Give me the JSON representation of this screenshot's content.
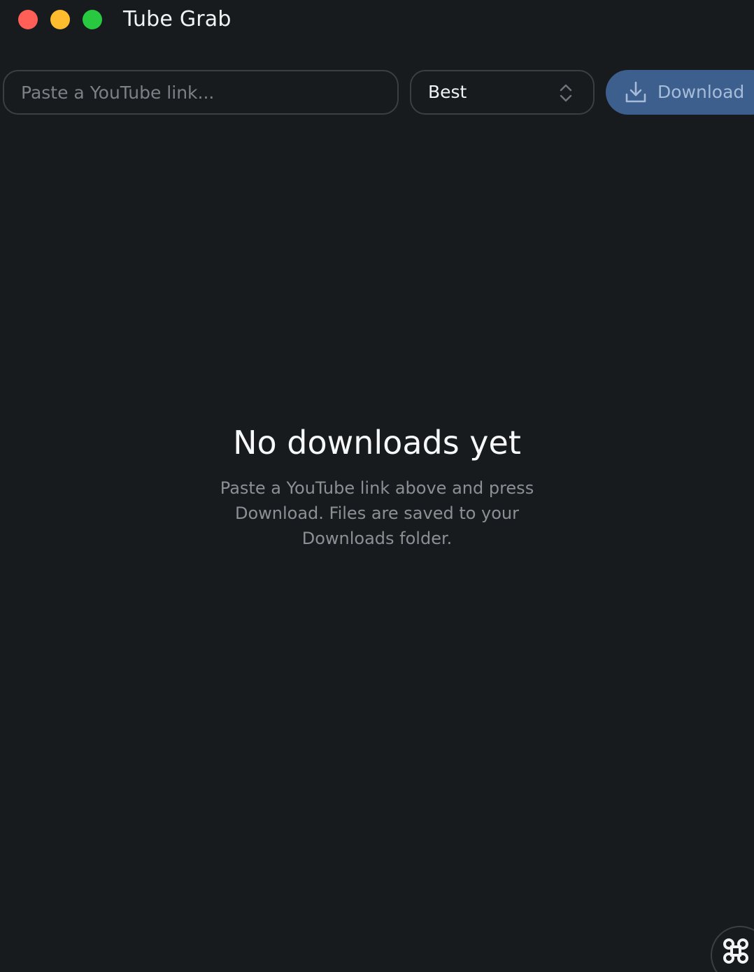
{
  "window": {
    "title": "Tube Grab",
    "controls": {
      "close_color": "#ff5f57",
      "minimize_color": "#febc2e",
      "zoom_color": "#28c840"
    }
  },
  "toolbar": {
    "url_input": {
      "placeholder": "Paste a YouTube link...",
      "value": ""
    },
    "quality_select": {
      "selected": "Best",
      "icon": "chevron-updown-icon"
    },
    "download_button": {
      "label": "Download",
      "icon": "download-icon",
      "color": "#3c5f8d"
    }
  },
  "empty_state": {
    "title": "No downloads yet",
    "description": "Paste a YouTube link above and press Download. Files are saved to your Downloads folder."
  },
  "corner_button": {
    "icon": "command-icon"
  }
}
